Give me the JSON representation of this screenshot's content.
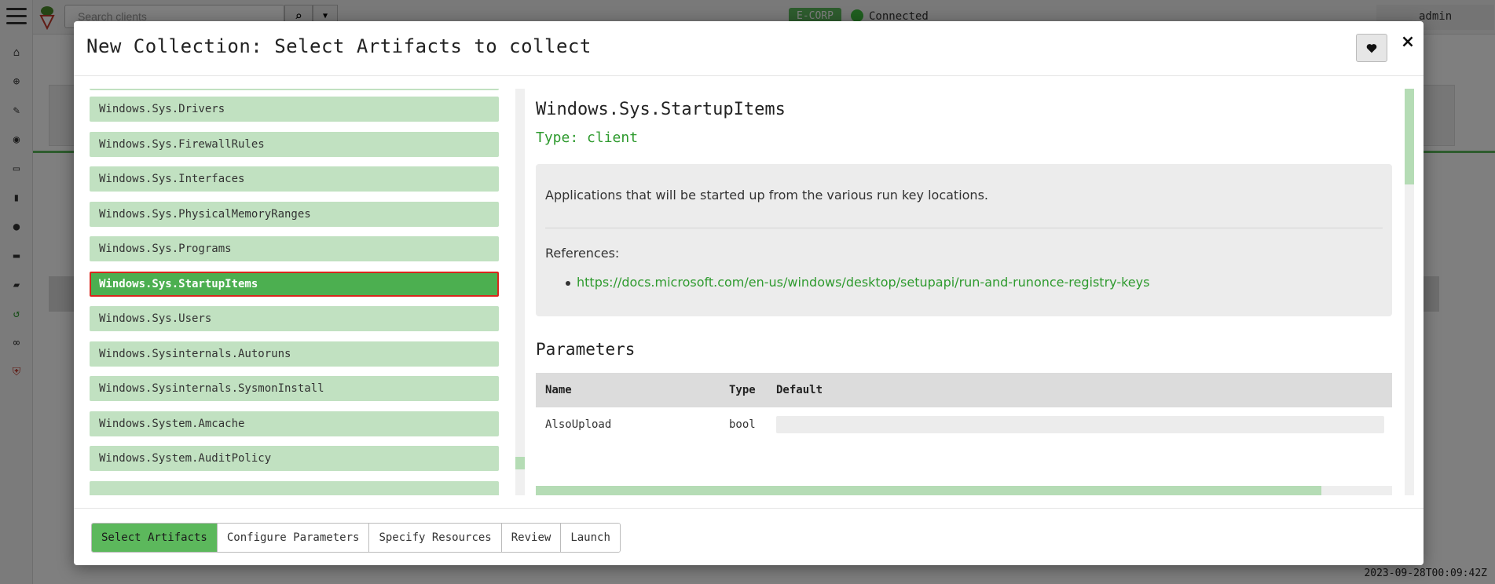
{
  "background": {
    "search_placeholder": "Search clients",
    "org": "E-CORP",
    "connection": "Connected",
    "user": "admin",
    "timestamp": "2023-09-28T00:09:42Z"
  },
  "modal": {
    "title": "New Collection: Select Artifacts to collect",
    "close_label": "×"
  },
  "artifacts": [
    {
      "label": "Windows.Sys.Drivers",
      "selected": false
    },
    {
      "label": "Windows.Sys.FirewallRules",
      "selected": false
    },
    {
      "label": "Windows.Sys.Interfaces",
      "selected": false
    },
    {
      "label": "Windows.Sys.PhysicalMemoryRanges",
      "selected": false
    },
    {
      "label": "Windows.Sys.Programs",
      "selected": false
    },
    {
      "label": "Windows.Sys.StartupItems",
      "selected": true
    },
    {
      "label": "Windows.Sys.Users",
      "selected": false
    },
    {
      "label": "Windows.Sysinternals.Autoruns",
      "selected": false
    },
    {
      "label": "Windows.Sysinternals.SysmonInstall",
      "selected": false
    },
    {
      "label": "Windows.System.Amcache",
      "selected": false
    },
    {
      "label": "Windows.System.AuditPolicy",
      "selected": false
    }
  ],
  "detail": {
    "title": "Windows.Sys.StartupItems",
    "type": "Type: client",
    "description": "Applications that will be started up from the various run key locations.",
    "references_label": "References:",
    "references": [
      "https://docs.microsoft.com/en-us/windows/desktop/setupapi/run-and-runonce-registry-keys"
    ],
    "parameters_heading": "Parameters",
    "param_columns": [
      "Name",
      "Type",
      "Default"
    ],
    "params": [
      {
        "name": "AlsoUpload",
        "type": "bool",
        "default": ""
      }
    ]
  },
  "wizard": {
    "steps": [
      "Select Artifacts",
      "Configure Parameters",
      "Specify Resources",
      "Review",
      "Launch"
    ],
    "active_index": 0
  },
  "colors": {
    "accent": "#5cb85c",
    "item_bg": "#c1e1c1",
    "selected_bg": "#4caf50",
    "selected_border": "#d9261c",
    "type_text": "#2e9a2e"
  }
}
